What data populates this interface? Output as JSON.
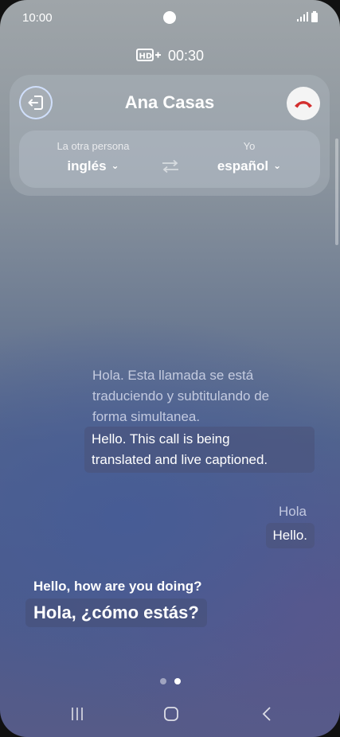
{
  "status_bar": {
    "time": "10:00"
  },
  "call": {
    "timer": "00:30",
    "contact_name": "Ana Casas"
  },
  "languages": {
    "other": {
      "caption": "La otra persona",
      "value": "inglés"
    },
    "me": {
      "caption": "Yo",
      "value": "español"
    }
  },
  "transcript": [
    {
      "original": [
        "Hola. Esta llamada se está",
        "traduciendo y subtitulando de",
        "forma simultanea."
      ],
      "translation": [
        "Hello. This call is being",
        "translated and live captioned."
      ]
    },
    {
      "original": [
        "Hola"
      ],
      "translation": [
        "Hello."
      ]
    }
  ],
  "live": {
    "original": "Hello, how are you doing?",
    "translation": "Hola, ¿cómo estás?"
  },
  "colors": {
    "end_call": "#d32f2f",
    "accent_ring": "#cfe0ff"
  }
}
